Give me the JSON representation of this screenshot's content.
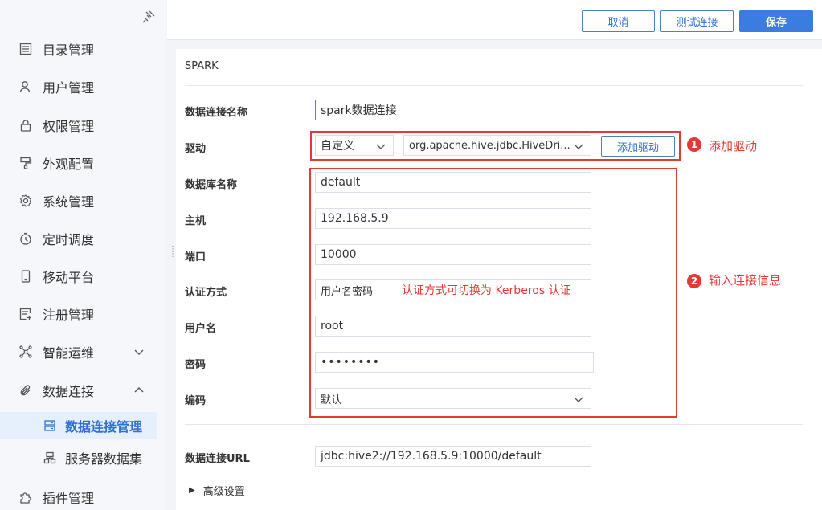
{
  "sidebar": {
    "items": [
      {
        "label": "目录管理"
      },
      {
        "label": "用户管理"
      },
      {
        "label": "权限管理"
      },
      {
        "label": "外观配置"
      },
      {
        "label": "系统管理"
      },
      {
        "label": "定时调度"
      },
      {
        "label": "移动平台"
      },
      {
        "label": "注册管理"
      },
      {
        "label": "智能运维"
      },
      {
        "label": "数据连接"
      },
      {
        "label": "插件管理"
      }
    ],
    "subitems": [
      {
        "label": "数据连接管理"
      },
      {
        "label": "服务器数据集"
      }
    ]
  },
  "toolbar": {
    "cancel_label": "取消",
    "test_label": "测试连接",
    "save_label": "保存"
  },
  "form": {
    "title": "SPARK",
    "conn_name_label": "数据连接名称",
    "conn_name_value": "spark数据连接",
    "driver_label": "驱动",
    "driver_type": "自定义",
    "driver_class": "org.apache.hive.jdbc.HiveDri...",
    "add_driver_label": "添加驱动",
    "db_name_label": "数据库名称",
    "db_name_value": "default",
    "host_label": "主机",
    "host_value": "192.168.5.9",
    "port_label": "端口",
    "port_value": "10000",
    "auth_label": "认证方式",
    "auth_value": "用户名密码",
    "auth_note": "认证方式可切换为 Kerberos 认证",
    "user_label": "用户名",
    "user_value": "root",
    "password_label": "密码",
    "password_value": "••••••••",
    "encoding_label": "编码",
    "encoding_value": "默认",
    "url_label": "数据连接URL",
    "url_value": "jdbc:hive2://192.168.5.9:10000/default",
    "advanced_label": "高级设置"
  },
  "annotations": {
    "badge1": "1",
    "note1": "添加驱动",
    "badge2": "2",
    "note2": "输入连接信息"
  },
  "colors": {
    "accent": "#3b7ce0",
    "highlight": "#e53935"
  }
}
